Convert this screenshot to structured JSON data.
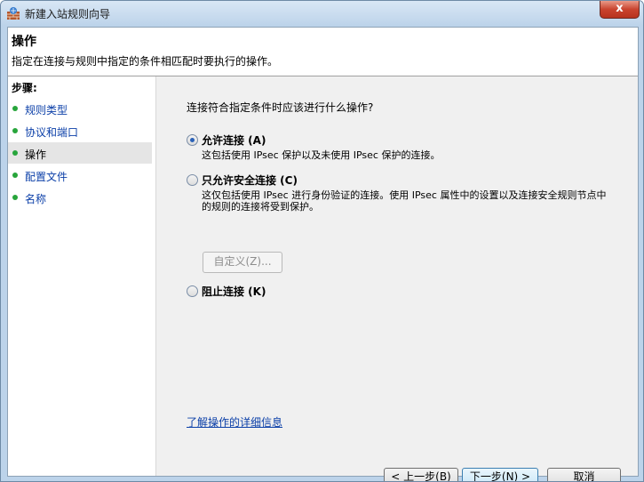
{
  "window": {
    "title": "新建入站规则向导",
    "close_glyph": "x"
  },
  "header": {
    "title": "操作",
    "description": "指定在连接与规则中指定的条件相匹配时要执行的操作。"
  },
  "steps": {
    "title": "步骤:",
    "items": [
      {
        "label": "规则类型"
      },
      {
        "label": "协议和端口"
      },
      {
        "label": "操作"
      },
      {
        "label": "配置文件"
      },
      {
        "label": "名称"
      }
    ],
    "active_index": 2
  },
  "main": {
    "question": "连接符合指定条件时应该进行什么操作?",
    "options": [
      {
        "label": "允许连接 (A)",
        "description": "这包括使用 IPsec 保护以及未使用 IPsec 保护的连接。",
        "selected": true
      },
      {
        "label": "只允许安全连接 (C)",
        "description": "这仅包括使用 IPsec 进行身份验证的连接。使用 IPsec 属性中的设置以及连接安全规则节点中的规则的连接将受到保护。",
        "selected": false
      },
      {
        "label": "阻止连接 (K)",
        "description": "",
        "selected": false
      }
    ],
    "customize_label": "自定义(Z)...",
    "learn_more": "了解操作的详细信息"
  },
  "buttons": {
    "back": "< 上一步(B)",
    "next": "下一步(N) >",
    "cancel": "取消"
  },
  "colors": {
    "accent": "#0b3fa8",
    "step_dot": "#27a53b",
    "frame": "#bcd3ea"
  }
}
